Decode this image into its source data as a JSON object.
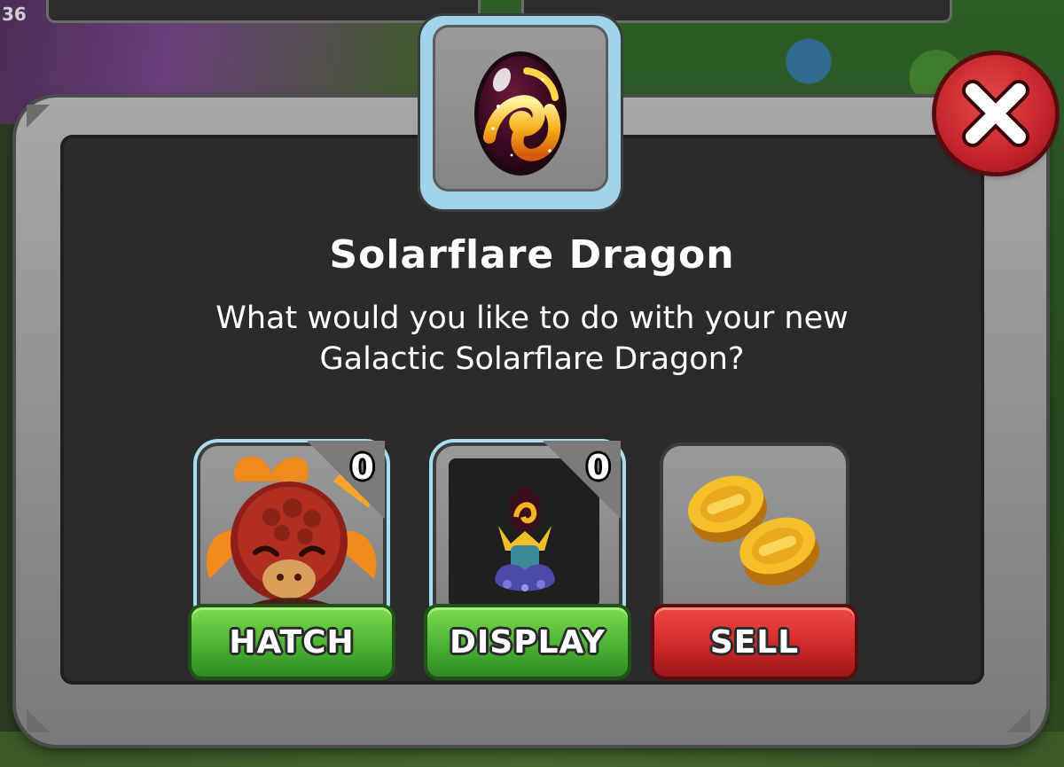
{
  "hud": {
    "corner_counter": "36"
  },
  "dialog": {
    "title": "Solarflare Dragon",
    "prompt_line1": "What would you like to do with your new",
    "prompt_line2": "Galactic Solarflare Dragon?",
    "egg_icon": "galactic-solarflare-egg",
    "close_icon": "close-x-icon"
  },
  "options": [
    {
      "id": "hatch",
      "label": "HATCH",
      "count": "0",
      "icon": "dragon-icon",
      "color": "#4bb334"
    },
    {
      "id": "display",
      "label": "DISPLAY",
      "count": "0",
      "icon": "egg-pedestal-icon",
      "color": "#4bb334"
    },
    {
      "id": "sell",
      "label": "SELL",
      "icon": "gold-coins-icon",
      "color": "#cf2a2a"
    }
  ]
}
